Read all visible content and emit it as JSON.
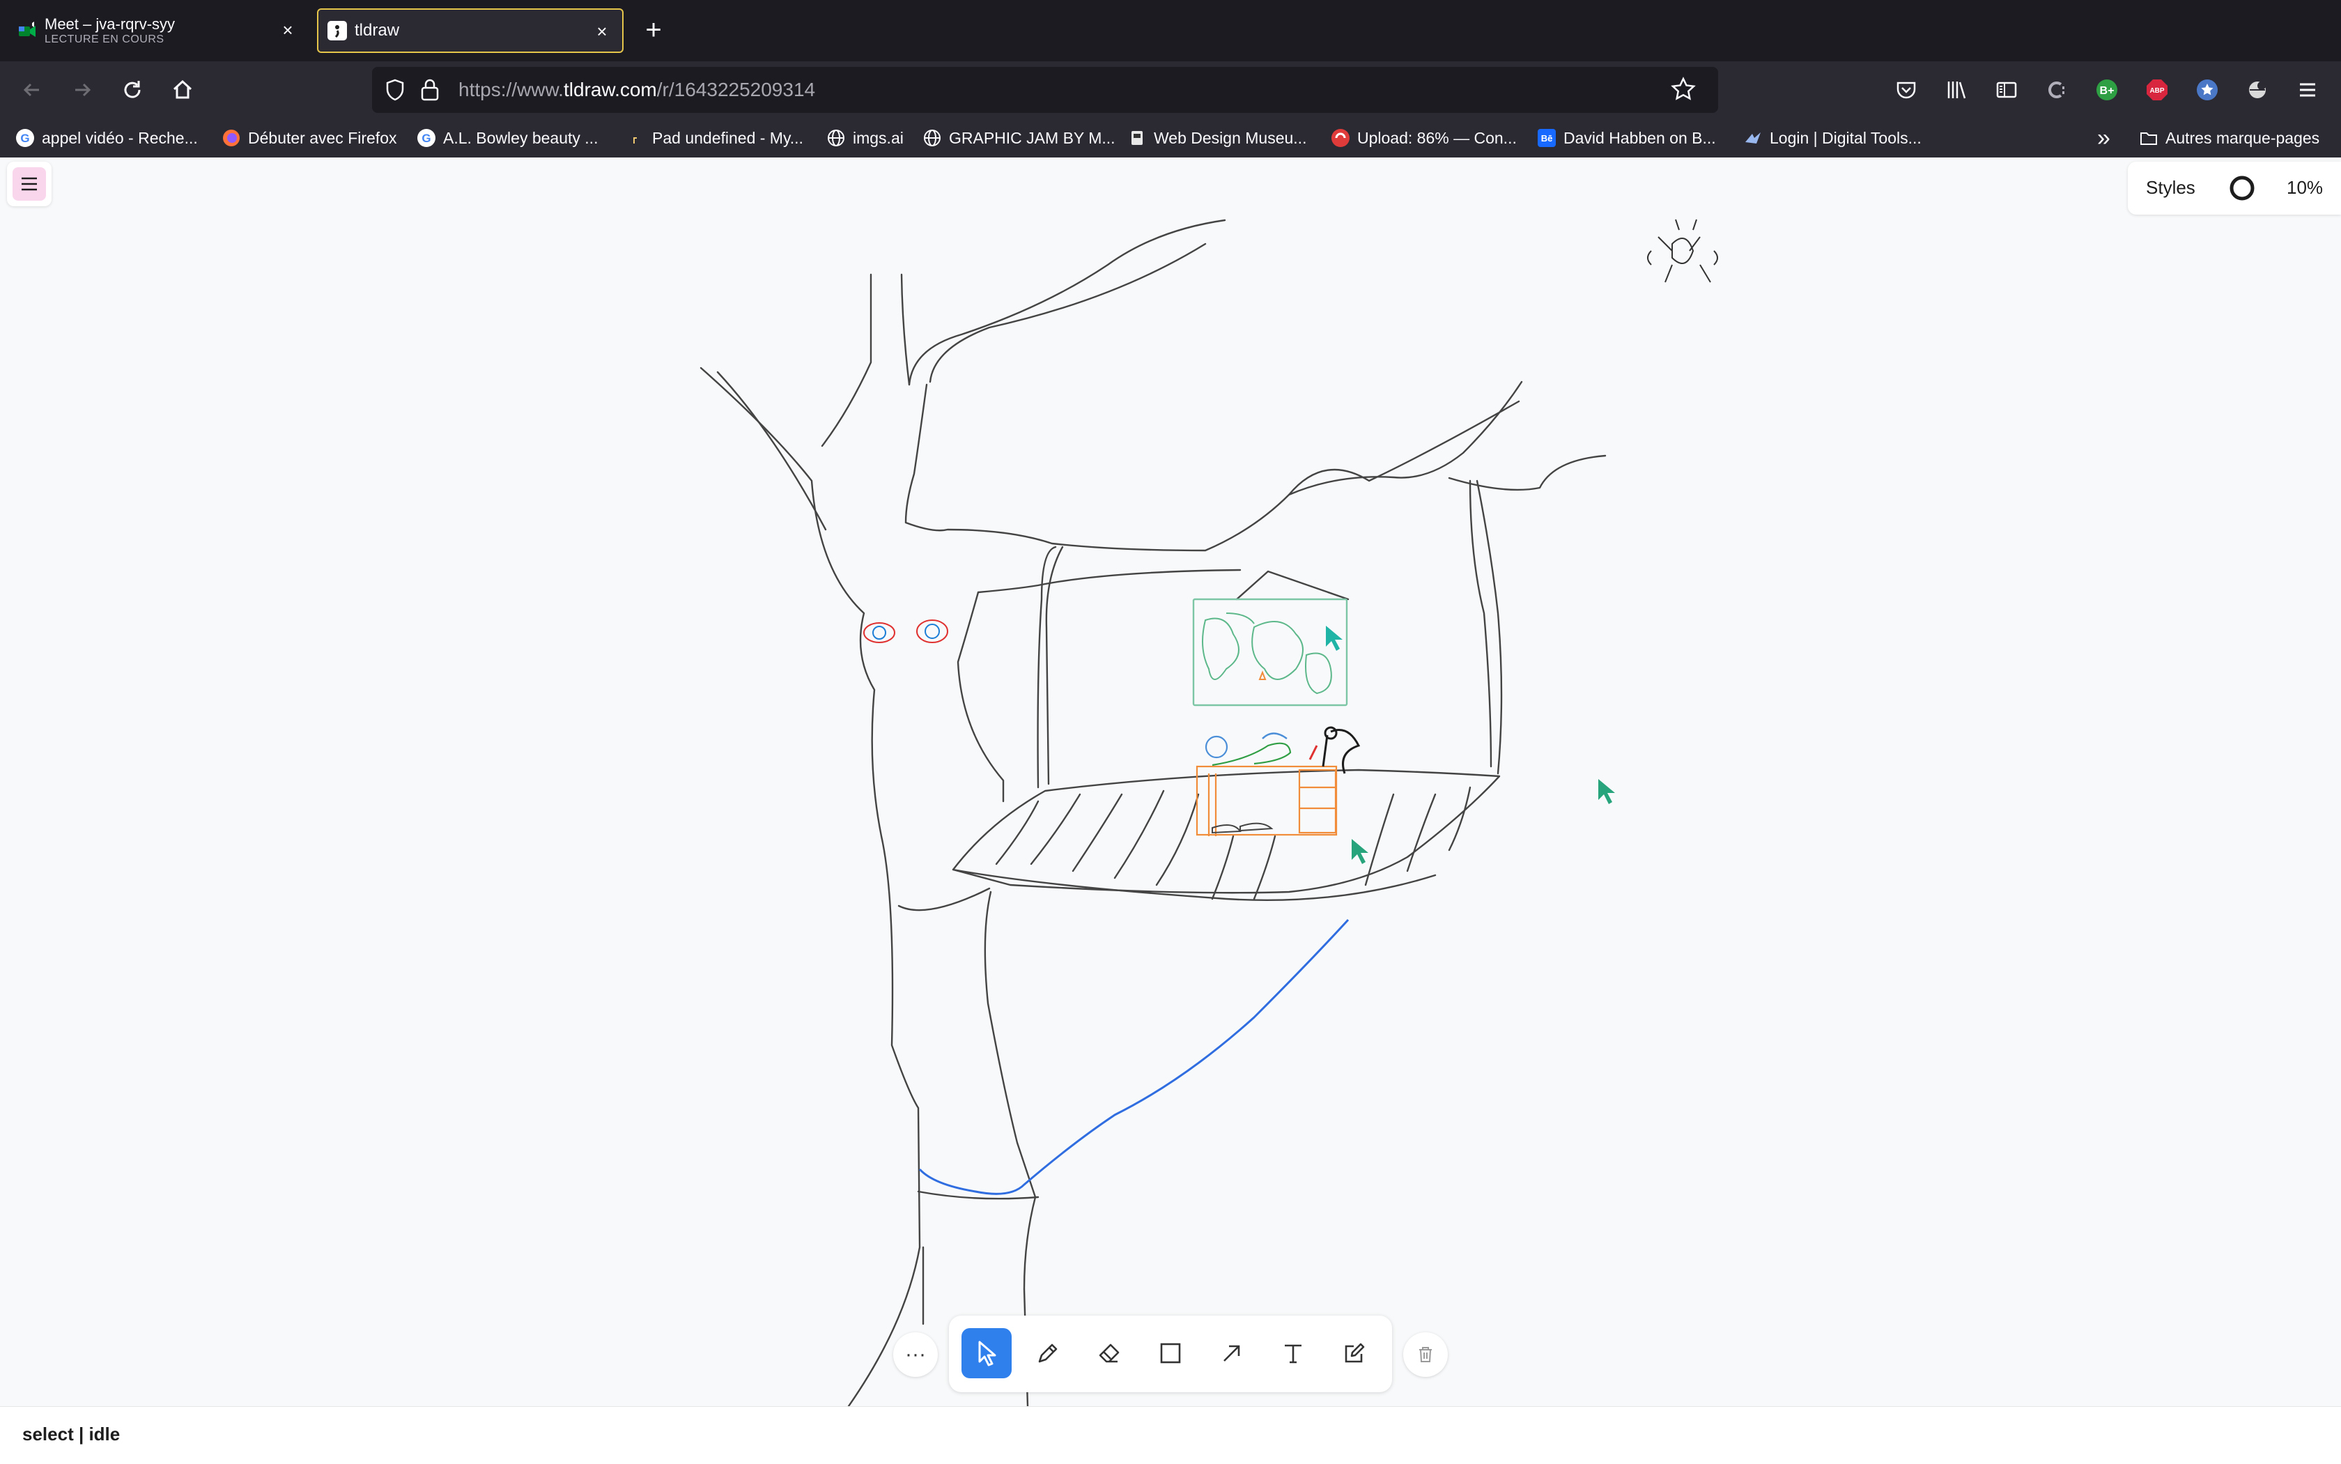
{
  "browser": {
    "tabs": [
      {
        "title": "Meet – jva-rqrv-syy",
        "subtitle": "LECTURE EN COURS",
        "icon": "meet-icon",
        "active": false
      },
      {
        "title": "tldraw",
        "icon": "tldraw-icon",
        "active": true
      }
    ],
    "new_tab_label": "+",
    "close_label": "×",
    "url": {
      "prefix": "https://www.",
      "domain": "tldraw.com",
      "path": "/r/1643225209314"
    },
    "bookmarks": [
      {
        "label": "appel vidéo - Reche...",
        "icon": "google-icon"
      },
      {
        "label": "Débuter avec Firefox",
        "icon": "firefox-icon"
      },
      {
        "label": "A.L. Bowley beauty ...",
        "icon": "google-icon"
      },
      {
        "label": "Pad undefined - My...",
        "icon": "pad-icon"
      },
      {
        "label": "imgs.ai",
        "icon": "globe-icon"
      },
      {
        "label": "GRAPHIC JAM BY M...",
        "icon": "globe-icon"
      },
      {
        "label": "Web Design Museu...",
        "icon": "museum-icon"
      },
      {
        "label": "Upload: 86% — Con...",
        "icon": "upload-icon"
      },
      {
        "label": "David Habben on B...",
        "icon": "behance-icon"
      },
      {
        "label": "Login | Digital Tools...",
        "icon": "bird-icon"
      }
    ],
    "overflow_label": "»",
    "other_bookmarks": "Autres marque-pages",
    "toolbar_icons": [
      "pocket-icon",
      "library-icon",
      "sidebar-icon",
      "extension-c-icon",
      "extension-bplus-icon",
      "abp-icon",
      "extension-star-icon",
      "extension-globe-icon",
      "hamburger-menu-icon"
    ]
  },
  "app": {
    "styles_label": "Styles",
    "zoom": "10%",
    "status": "select | idle",
    "more_label": "···",
    "tools": [
      {
        "name": "select",
        "icon": "cursor-icon",
        "active": true
      },
      {
        "name": "draw",
        "icon": "pencil-icon",
        "active": false
      },
      {
        "name": "eraser",
        "icon": "eraser-icon",
        "active": false
      },
      {
        "name": "rectangle",
        "icon": "rectangle-icon",
        "active": false
      },
      {
        "name": "arrow",
        "icon": "arrow-icon",
        "active": false
      },
      {
        "name": "text",
        "icon": "text-icon",
        "active": false
      },
      {
        "name": "sticky",
        "icon": "sticky-note-icon",
        "active": false
      }
    ]
  },
  "colors": {
    "tab_active_border": "#e5c54a",
    "chrome_dark": "#1c1b22",
    "chrome": "#2b2a33",
    "accent_blue": "#2f80ed",
    "menu_pink": "#f9d6ec"
  }
}
